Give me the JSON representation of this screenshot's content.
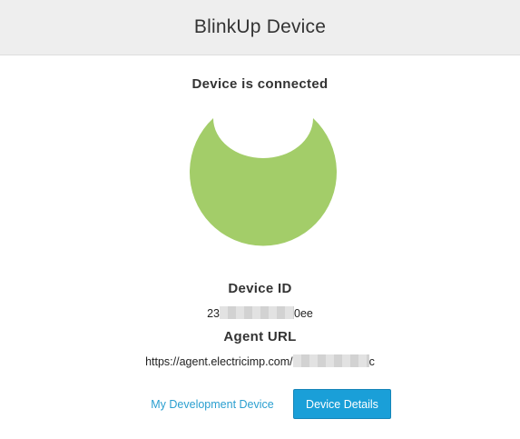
{
  "header": {
    "title": "BlinkUp Device"
  },
  "status": {
    "text": "Device is connected"
  },
  "device_graphic": {
    "icon": "device-status-icon",
    "color": "#a3cd69"
  },
  "device_id": {
    "label": "Device ID",
    "value_prefix": "23",
    "value_suffix": "0ee"
  },
  "agent_url": {
    "label": "Agent URL",
    "value_prefix": "https://agent.electricimp.com/",
    "value_suffix": "c"
  },
  "actions": {
    "dev_device_link": "My Development Device",
    "details_button": "Device Details"
  },
  "colors": {
    "accent": "#1a9fd8",
    "link": "#2a9fd0",
    "header_bg": "#eeeeee"
  }
}
